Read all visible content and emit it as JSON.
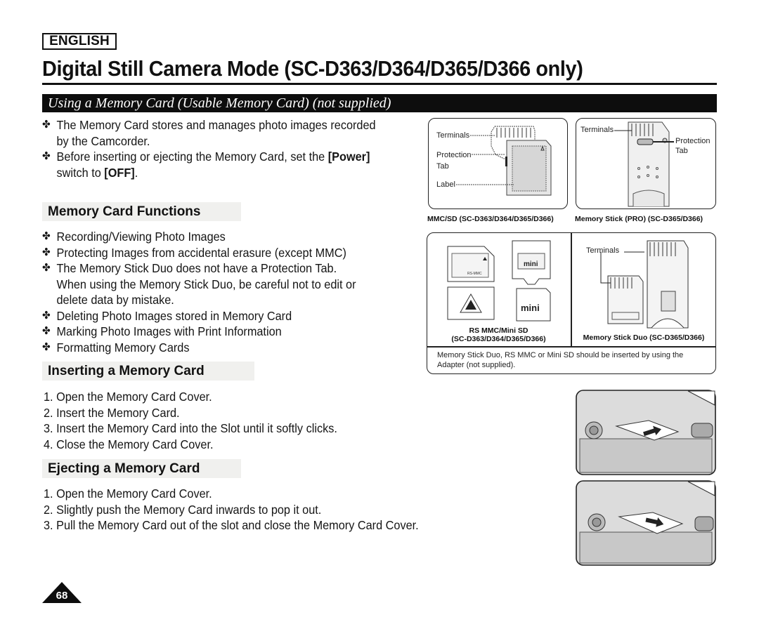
{
  "language_badge": "ENGLISH",
  "page_title": "Digital Still Camera Mode (SC-D363/D364/D365/D366 only)",
  "section_title": "Using a Memory Card (Usable Memory Card) (not supplied)",
  "bullet_marker": "✤",
  "intro": [
    {
      "line1": "The Memory Card stores and manages photo images recorded",
      "line2": "by the Camcorder."
    },
    {
      "line1_pre": "Before inserting or ejecting the Memory Card, set the ",
      "line1_bold": "[Power]",
      "line2_pre": "switch to ",
      "line2_bold": "[OFF]",
      "line2_post": "."
    }
  ],
  "functions": {
    "heading": "Memory Card Functions",
    "items": [
      "Recording/Viewing Photo Images",
      "Protecting Images from accidental erasure (except MMC)",
      "The Memory Stick Duo does not have a Protection Tab.",
      "Deleting Photo Images stored in Memory Card",
      "Marking Photo Images with Print Information",
      "Formatting Memory Cards"
    ],
    "item3_cont1": "When using the Memory Stick Duo, be careful not to edit or",
    "item3_cont2": "delete data by mistake."
  },
  "inserting": {
    "heading": "Inserting a Memory Card",
    "steps": [
      "1. Open the Memory Card Cover.",
      "2. Insert the Memory Card.",
      "3. Insert the Memory Card into the Slot until it softly clicks.",
      "4. Close the Memory Card Cover."
    ]
  },
  "ejecting": {
    "heading": "Ejecting a Memory Card",
    "steps": [
      "1. Open the Memory Card Cover.",
      "2. Slightly push the Memory Card inwards to pop it out.",
      "3. Pull the Memory Card out of the slot and close the Memory Card Cover."
    ]
  },
  "figures": {
    "mmc_sd": {
      "labels": {
        "terminals": "Terminals",
        "protection": "Protection",
        "tab": "Tab",
        "label": "Label"
      },
      "caption_bold": "MMC/SD (SC-D363/D364/D365/D366)"
    },
    "memory_stick_pro": {
      "labels": {
        "terminals": "Terminals",
        "protection": "Protection",
        "tab": "Tab"
      },
      "caption": "Memory Stick (PRO) (SC-D365/D366)"
    },
    "rs_mmc_mini_sd": {
      "card_text_rs": "RS-MMC",
      "card_text_mini": "mini",
      "caption_line1": "RS MMC/Mini SD",
      "caption_line2": "(SC-D363/D364/D365/D366)"
    },
    "memory_stick_duo": {
      "labels": {
        "terminals": "Terminals"
      },
      "caption": "Memory Stick Duo (SC-D365/D366)"
    },
    "adapter_note": "Memory Stick Duo, RS MMC or Mini SD should be inserted by using the Adapter (not supplied)."
  },
  "page_number": "68"
}
